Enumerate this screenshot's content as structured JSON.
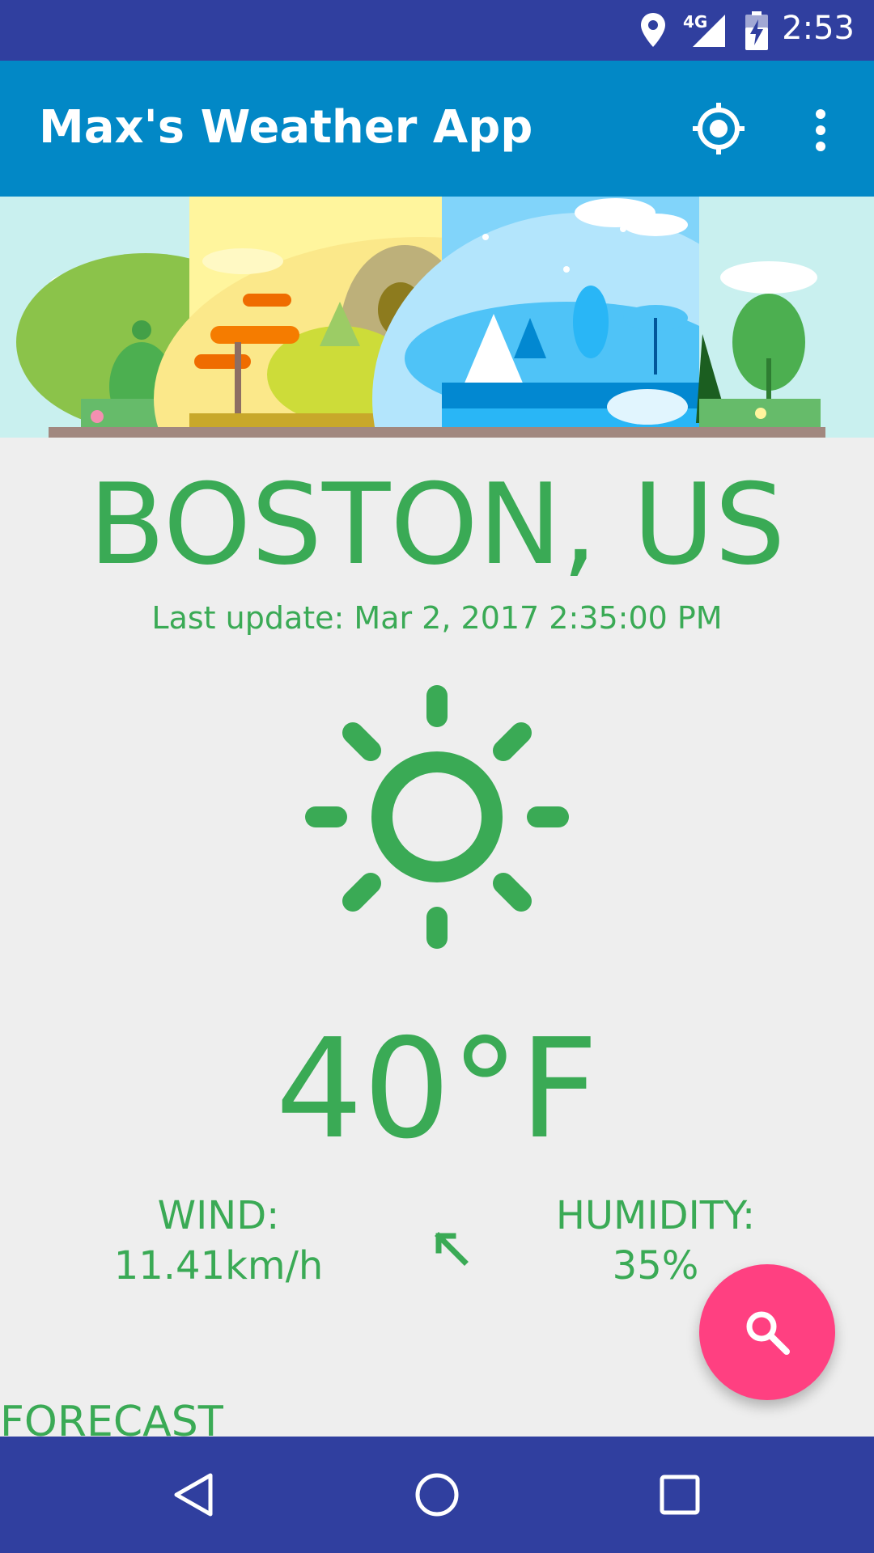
{
  "status_bar": {
    "time": "2:53",
    "network": "4G",
    "icons": [
      "location-icon",
      "signal-4g-icon",
      "battery-charging-icon"
    ]
  },
  "app_bar": {
    "title": "Max's Weather App",
    "actions": [
      "my-location-icon",
      "overflow-menu-icon"
    ]
  },
  "weather": {
    "city": "BOSTON, US",
    "last_update": "Last update: Mar 2, 2017 2:35:00 PM",
    "condition_icon": "sun-icon",
    "temperature": "40°F",
    "wind_label": "WIND:",
    "wind_value": "11.41km/h",
    "wind_direction_icon": "arrow-up-left-icon",
    "humidity_label": "HUMIDITY:",
    "humidity_value": "35%"
  },
  "forecast": {
    "heading": "FORECAST"
  },
  "fab": {
    "icon": "search-icon"
  },
  "nav_bar": {
    "buttons": [
      "back-icon",
      "home-icon",
      "recents-icon"
    ]
  },
  "colors": {
    "status_bar": "#303f9f",
    "app_bar": "#0288c6",
    "accent_green": "#3aaa55",
    "fab": "#ff4081",
    "background": "#eeeeee"
  }
}
